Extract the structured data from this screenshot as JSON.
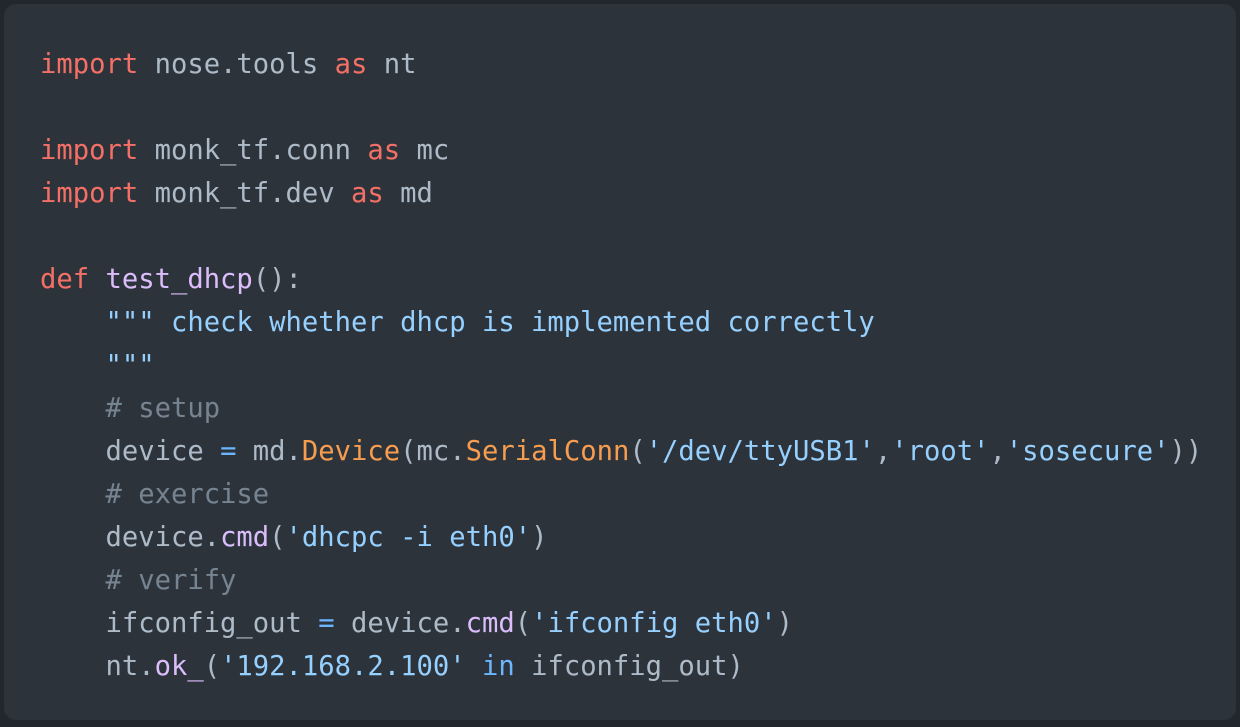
{
  "colors": {
    "page_background": "#22272e",
    "code_background": "#2d333b",
    "default_text": "#adbac7",
    "keyword": "#f47067",
    "function": "#dcbdfb",
    "class": "#f69d50",
    "string": "#96d0ff",
    "operator": "#6cb6ff",
    "comment": "#768390"
  },
  "code": {
    "language": "python",
    "lines": [
      [
        {
          "t": "kw",
          "v": "import"
        },
        {
          "t": "tx",
          "v": " nose.tools "
        },
        {
          "t": "kw",
          "v": "as"
        },
        {
          "t": "tx",
          "v": " nt"
        }
      ],
      [],
      [
        {
          "t": "kw",
          "v": "import"
        },
        {
          "t": "tx",
          "v": " monk_tf.conn "
        },
        {
          "t": "kw",
          "v": "as"
        },
        {
          "t": "tx",
          "v": " mc"
        }
      ],
      [
        {
          "t": "kw",
          "v": "import"
        },
        {
          "t": "tx",
          "v": " monk_tf.dev "
        },
        {
          "t": "kw",
          "v": "as"
        },
        {
          "t": "tx",
          "v": " md"
        }
      ],
      [],
      [
        {
          "t": "kw",
          "v": "def"
        },
        {
          "t": "tx",
          "v": " "
        },
        {
          "t": "fn",
          "v": "test_dhcp"
        },
        {
          "t": "tx",
          "v": "():"
        }
      ],
      [
        {
          "t": "tx",
          "v": "    "
        },
        {
          "t": "str",
          "v": "\"\"\" check whether dhcp is implemented correctly"
        }
      ],
      [
        {
          "t": "tx",
          "v": "    "
        },
        {
          "t": "str",
          "v": "\"\"\""
        }
      ],
      [
        {
          "t": "tx",
          "v": "    "
        },
        {
          "t": "cm",
          "v": "# setup"
        }
      ],
      [
        {
          "t": "tx",
          "v": "    device "
        },
        {
          "t": "op",
          "v": "="
        },
        {
          "t": "tx",
          "v": " md."
        },
        {
          "t": "cls",
          "v": "Device"
        },
        {
          "t": "tx",
          "v": "(mc."
        },
        {
          "t": "cls",
          "v": "SerialConn"
        },
        {
          "t": "tx",
          "v": "("
        },
        {
          "t": "str",
          "v": "'/dev/ttyUSB1'"
        },
        {
          "t": "tx",
          "v": ","
        },
        {
          "t": "str",
          "v": "'root'"
        },
        {
          "t": "tx",
          "v": ","
        },
        {
          "t": "str",
          "v": "'sosecure'"
        },
        {
          "t": "tx",
          "v": "))"
        }
      ],
      [
        {
          "t": "tx",
          "v": "    "
        },
        {
          "t": "cm",
          "v": "# exercise"
        }
      ],
      [
        {
          "t": "tx",
          "v": "    device."
        },
        {
          "t": "fn",
          "v": "cmd"
        },
        {
          "t": "tx",
          "v": "("
        },
        {
          "t": "str",
          "v": "'dhcpc -i eth0'"
        },
        {
          "t": "tx",
          "v": ")"
        }
      ],
      [
        {
          "t": "tx",
          "v": "    "
        },
        {
          "t": "cm",
          "v": "# verify"
        }
      ],
      [
        {
          "t": "tx",
          "v": "    ifconfig_out "
        },
        {
          "t": "op",
          "v": "="
        },
        {
          "t": "tx",
          "v": " device."
        },
        {
          "t": "fn",
          "v": "cmd"
        },
        {
          "t": "tx",
          "v": "("
        },
        {
          "t": "str",
          "v": "'ifconfig eth0'"
        },
        {
          "t": "tx",
          "v": ")"
        }
      ],
      [
        {
          "t": "tx",
          "v": "    nt."
        },
        {
          "t": "fn",
          "v": "ok_"
        },
        {
          "t": "tx",
          "v": "("
        },
        {
          "t": "str",
          "v": "'192.168.2.100'"
        },
        {
          "t": "tx",
          "v": " "
        },
        {
          "t": "op",
          "v": "in"
        },
        {
          "t": "tx",
          "v": " ifconfig_out)"
        }
      ]
    ]
  }
}
